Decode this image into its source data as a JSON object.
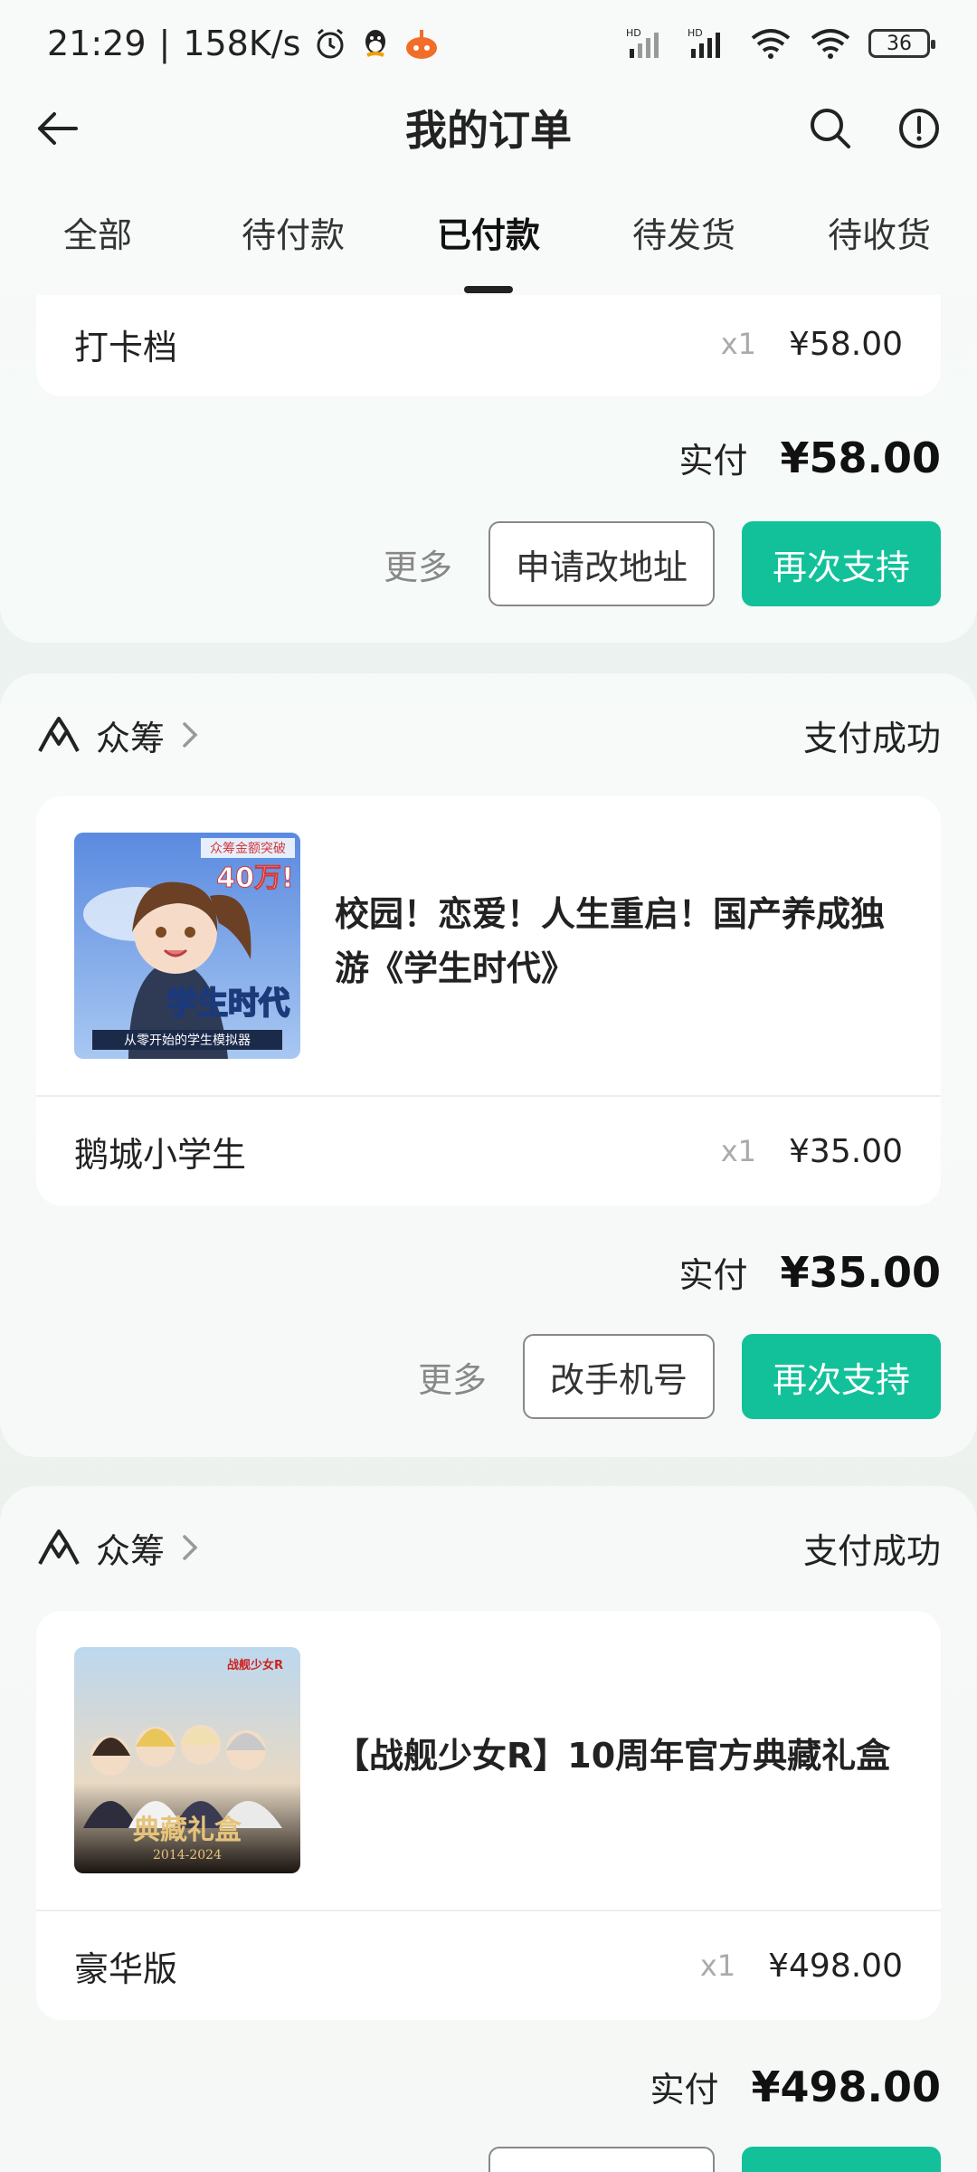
{
  "status_bar": {
    "time": "21:29",
    "speed": "158K/s",
    "network": "HD",
    "battery": "36"
  },
  "header": {
    "title": "我的订单"
  },
  "tabs": [
    {
      "label": "全部"
    },
    {
      "label": "待付款"
    },
    {
      "label": "已付款",
      "active": true
    },
    {
      "label": "待发货"
    },
    {
      "label": "待收货"
    }
  ],
  "labels": {
    "paid": "实付",
    "more": "更多",
    "support_again": "再次支持",
    "qty_prefix": "x"
  },
  "orders": [
    {
      "sku": {
        "name": "打卡档",
        "qty": "x1",
        "price": "¥58.00"
      },
      "paid_amount": "¥58.00",
      "secondary_action": "申请改地址"
    },
    {
      "source": "众筹",
      "status": "支付成功",
      "product": {
        "title": "校园！恋爱！人生重启！国产养成独游《学生时代》",
        "image_caption_top": "众筹金额突破",
        "image_caption_big": "40万!",
        "image_caption_logo": "学生时代",
        "image_caption_bottom": "从零开始的学生模拟器"
      },
      "sku": {
        "name": "鹅城小学生",
        "qty": "x1",
        "price": "¥35.00"
      },
      "paid_amount": "¥35.00",
      "secondary_action": "改手机号"
    },
    {
      "source": "众筹",
      "status": "支付成功",
      "product": {
        "title": "【战舰少女R】10周年官方典藏礼盒",
        "image_caption_top": "战舰少女R",
        "image_caption_logo": "典藏礼盒",
        "image_caption_bottom": "2014-2024"
      },
      "sku": {
        "name": "豪华版",
        "qty": "x1",
        "price": "¥498.00"
      },
      "paid_amount": "¥498.00",
      "secondary_action": ""
    }
  ],
  "colors": {
    "accent": "#12c19a",
    "background": "#eef3f0"
  }
}
